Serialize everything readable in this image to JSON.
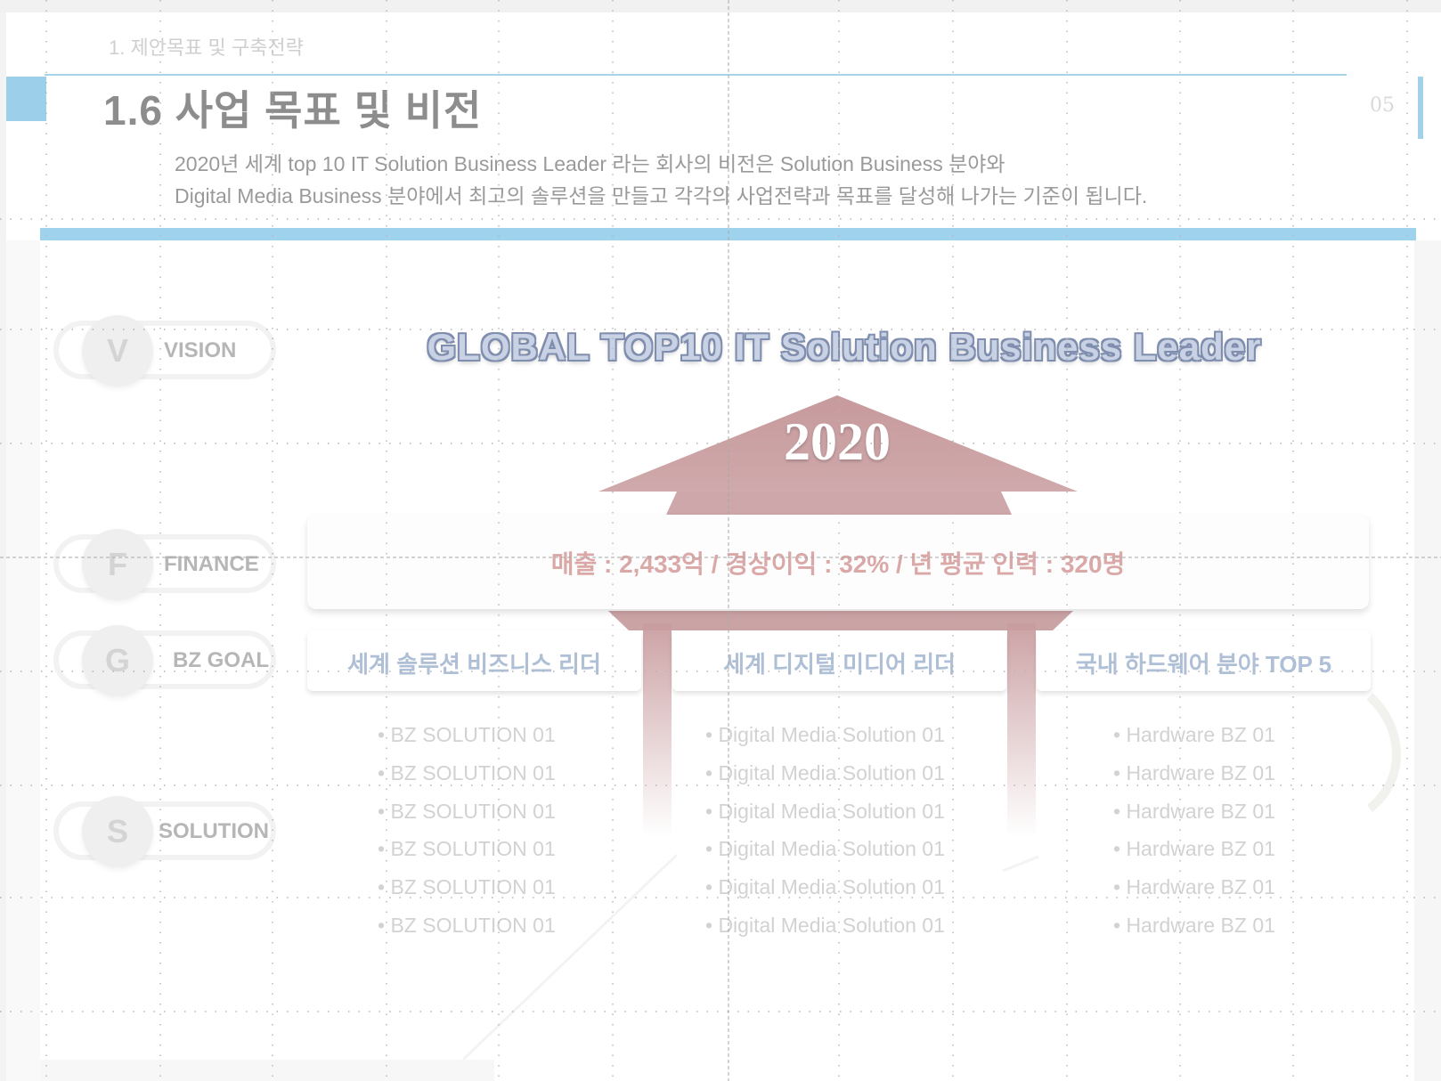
{
  "header": {
    "breadcrumb": "1. 제안목표 및 구축전략",
    "title": "1.6 사업 목표 및 비전",
    "page_number": "05",
    "description_line1": "2020년 세계 top 10 IT Solution Business Leader 라는 회사의 비전은 Solution Business 분야와",
    "description_line2": "Digital Media Business 분야에서 최고의 솔루션을 만들고 각각의 사업전략과 목표를 달성해 나가는 기준이 됩니다."
  },
  "rows": {
    "vision": {
      "letter": "V",
      "label": "VISION"
    },
    "finance": {
      "letter": "F",
      "label": "FINANCE"
    },
    "goal": {
      "letter": "G",
      "label": "BZ GOAL"
    },
    "solution": {
      "letter": "S",
      "label": "SOLUTION"
    }
  },
  "vision_text": "GLOBAL TOP10 IT Solution Business Leader",
  "year": "2020",
  "finance_text": "매출 : 2,433억 / 경상이익 : 32% / 년 평균 인력 : 320명",
  "goals": [
    "세계 솔루션 비즈니스 리더",
    "세계 디지털 미디어 리더",
    "국내 하드웨어 분야 TOP 5"
  ],
  "solutions": {
    "col1": [
      "• BZ SOLUTION 01",
      "• BZ SOLUTION 01",
      "• BZ SOLUTION 01",
      "• BZ SOLUTION 01",
      "• BZ SOLUTION 01",
      "• BZ SOLUTION 01"
    ],
    "col2": [
      "• Digital Media Solution 01",
      "• Digital Media Solution 01",
      "• Digital Media Solution 01",
      "• Digital Media Solution 01",
      "• Digital Media Solution 01",
      "• Digital Media Solution 01"
    ],
    "col3": [
      "• Hardware BZ 01",
      "• Hardware BZ 01",
      "• Hardware BZ 01",
      "• Hardware BZ 01",
      "• Hardware BZ 01",
      "• Hardware BZ 01"
    ]
  },
  "colors": {
    "accent_blue": "#9fd2ec",
    "arrow_rose": "#c99da0",
    "finance_text": "#dba8a8",
    "goal_text": "#aebfd6"
  }
}
